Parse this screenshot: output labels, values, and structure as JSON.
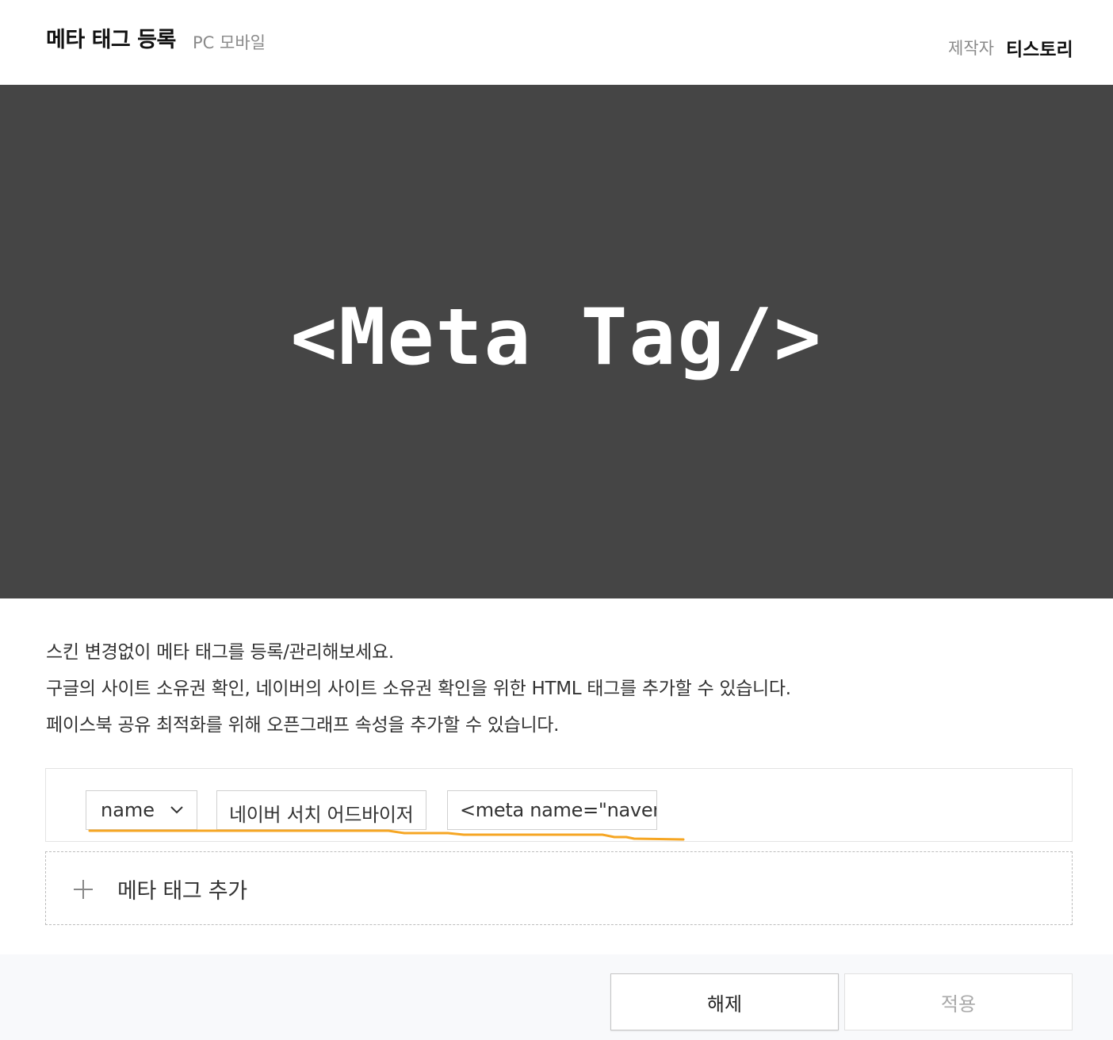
{
  "header": {
    "title": "메타 태그 등록",
    "platforms": "PC 모바일",
    "maker_label": "제작자",
    "maker_name": "티스토리"
  },
  "banner": {
    "text": "<Meta Tag/>",
    "background": "#454545"
  },
  "description": {
    "lines": [
      "스킨 변경없이 메타 태그를 등록/관리해보세요.",
      "구글의 사이트 소유권 확인, 네이버의 사이트 소유권 확인을 위한 HTML 태그를 추가할 수 있습니다.",
      "페이스북 공유 최적화를 위해 오픈그래프 속성을 추가할 수 있습니다."
    ]
  },
  "meta_tags": [
    {
      "attribute": "name",
      "label": "네이버 서치 어드바이저",
      "content": "<meta name=\"naver-site-verification\""
    }
  ],
  "add_tag": {
    "icon": "plus-icon",
    "label": "메타 태그 추가"
  },
  "footer": {
    "release_label": "해제",
    "apply_label": "적용"
  },
  "colors": {
    "annotation": "#f6a623"
  }
}
